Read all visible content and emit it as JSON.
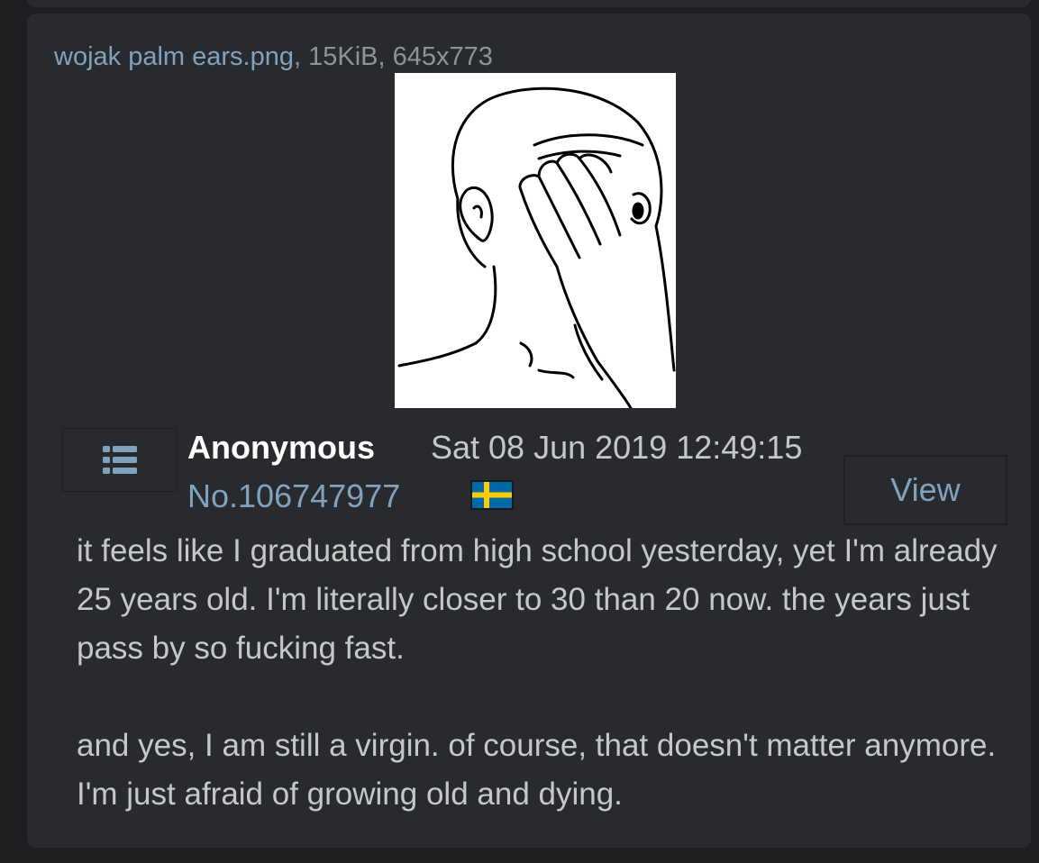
{
  "post": {
    "file": {
      "name": "wojak palm ears.png",
      "meta": ", 15KiB, 645x773",
      "thumbnail_alt": "wojak palm ears"
    },
    "menu_icon": "list-icon",
    "name": "Anonymous",
    "date": "Sat 08 Jun 2019 12:49:15",
    "number": "No.106747977",
    "flag_icon": "sweden-flag-icon",
    "view_label": "View",
    "message": [
      "it feels like I graduated from high school yesterday, yet I'm already 25 years old. I'm literally closer to 30 than 20 now. the years just pass by so fucking fast.",
      "and yes, I am still a virgin. of course, that doesn't matter anymore. I'm just afraid of growing old and dying."
    ]
  },
  "colors": {
    "background": "#1d1e20",
    "card": "#282a2e",
    "link": "#81a2be",
    "text": "#c5c8c6",
    "muted": "#8f9398",
    "flag_blue": "#006aa7",
    "flag_yellow": "#fecc00"
  }
}
